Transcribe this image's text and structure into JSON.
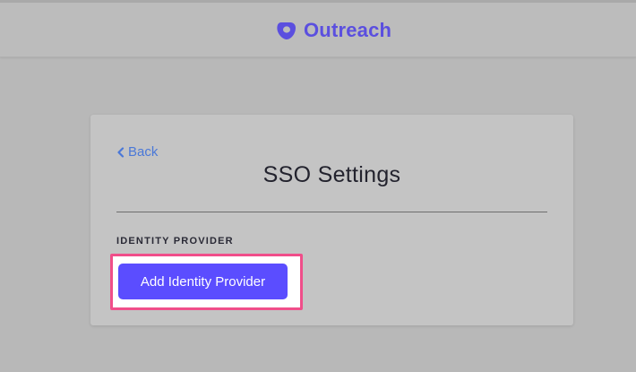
{
  "header": {
    "brand_name": "Outreach",
    "brand_color": "#5b4fdf",
    "logo_icon": "outreach-logo-icon"
  },
  "card": {
    "back_label": "Back",
    "back_icon": "chevron-left-icon",
    "title": "SSO Settings",
    "section_label": "IDENTITY PROVIDER",
    "add_button_label": "Add Identity Provider",
    "add_button_color": "#5b4dff",
    "link_color": "#4a78d8",
    "highlight_color": "#f04e8a"
  }
}
